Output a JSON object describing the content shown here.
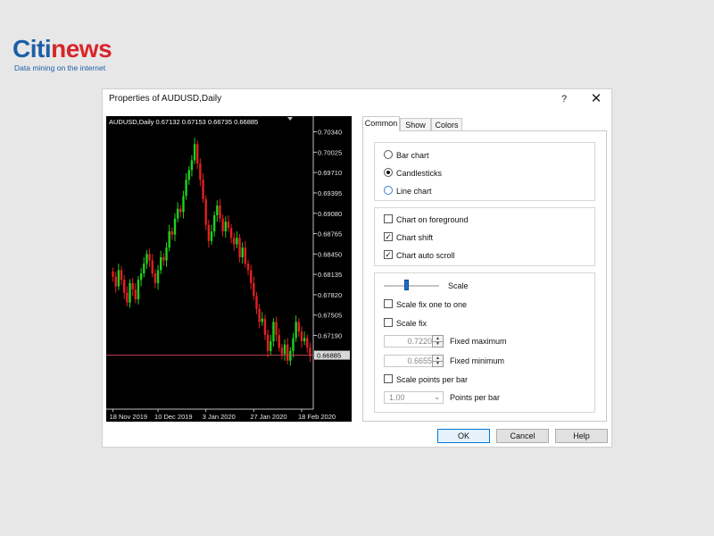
{
  "logo": {
    "brand_main": "Citi",
    "brand_accent": "news",
    "tagline": "Data mining on the internet"
  },
  "dialog": {
    "title": "Properties of AUDUSD,Daily",
    "help_glyph": "?",
    "close_glyph": "✕",
    "buttons": {
      "ok": "OK",
      "cancel": "Cancel",
      "help": "Help"
    }
  },
  "tabs": [
    {
      "label": "Common",
      "active": true
    },
    {
      "label": "Show"
    },
    {
      "label": "Colors"
    }
  ],
  "chart_type_group": {
    "bar_chart": {
      "label": "Bar chart",
      "selected": false
    },
    "candlesticks": {
      "label": "Candlesticks",
      "selected": true
    },
    "line_chart": {
      "label": "Line chart",
      "selected": false
    }
  },
  "options_group": {
    "foreground": {
      "label": "Chart on foreground",
      "checked": false
    },
    "shift": {
      "label": "Chart shift",
      "checked": true
    },
    "auto_scroll": {
      "label": "Chart auto scroll",
      "checked": true
    }
  },
  "scale_group": {
    "scale_label": "Scale",
    "scale_value": 0.45,
    "fix_one_to_one": {
      "label": "Scale fix one to one",
      "checked": false
    },
    "scale_fix": {
      "label": "Scale fix",
      "checked": false
    },
    "fixed_maximum": {
      "label": "Fixed maximum",
      "value": "0.72200"
    },
    "fixed_minimum": {
      "label": "Fixed minimum",
      "value": "0.66550"
    },
    "points_per_bar_check": {
      "label": "Scale points per bar",
      "checked": false
    },
    "points_per_bar": {
      "label": "Points per bar",
      "value": "1.00"
    }
  },
  "colors": {
    "bull": "#1fd01f",
    "bear": "#e32020",
    "price_line": "#c24050",
    "ok_border": "#0078d7",
    "logo_blue": "#1c5fa8",
    "logo_red": "#d7262a"
  },
  "chart_data": {
    "type": "candlestick",
    "title": "AUDUSD,Daily  0.67132 0.67153 0.66735 0.66885",
    "current_price": 0.66885,
    "current_price_label": "0.66885",
    "ylim": [
      0.6605,
      0.705
    ],
    "y_ticks": [
      {
        "value": 0.7034,
        "label": "0.70340"
      },
      {
        "value": 0.70025,
        "label": "0.70025"
      },
      {
        "value": 0.6971,
        "label": "0.69710"
      },
      {
        "value": 0.69395,
        "label": "0.69395"
      },
      {
        "value": 0.6908,
        "label": "0.69080"
      },
      {
        "value": 0.68765,
        "label": "0.68765"
      },
      {
        "value": 0.6845,
        "label": "0.68450"
      },
      {
        "value": 0.68135,
        "label": "0.68135"
      },
      {
        "value": 0.6782,
        "label": "0.67820"
      },
      {
        "value": 0.67505,
        "label": "0.67505"
      },
      {
        "value": 0.6719,
        "label": "0.67190"
      }
    ],
    "x_ticks": [
      {
        "index": 0,
        "label": "18 Nov 2019"
      },
      {
        "index": 16,
        "label": "10 Dec 2019"
      },
      {
        "index": 33,
        "label": "3 Jan 2020"
      },
      {
        "index": 50,
        "label": "27 Jan 2020"
      },
      {
        "index": 67,
        "label": "18 Feb 2020"
      }
    ],
    "close_series": [
      0.681,
      0.6795,
      0.682,
      0.6805,
      0.6785,
      0.677,
      0.68,
      0.679,
      0.6775,
      0.6805,
      0.6815,
      0.683,
      0.6845,
      0.6835,
      0.6815,
      0.68,
      0.682,
      0.684,
      0.6835,
      0.6855,
      0.688,
      0.6875,
      0.69,
      0.6915,
      0.691,
      0.6935,
      0.696,
      0.6975,
      0.699,
      0.7015,
      0.6985,
      0.696,
      0.693,
      0.689,
      0.6865,
      0.688,
      0.6905,
      0.692,
      0.69,
      0.688,
      0.6895,
      0.6885,
      0.687,
      0.686,
      0.687,
      0.684,
      0.6855,
      0.683,
      0.682,
      0.68,
      0.678,
      0.676,
      0.674,
      0.6745,
      0.672,
      0.6695,
      0.671,
      0.674,
      0.672,
      0.67,
      0.669,
      0.6705,
      0.668,
      0.6695,
      0.6715,
      0.674,
      0.6725,
      0.671,
      0.6715,
      0.67,
      0.6688
    ]
  }
}
